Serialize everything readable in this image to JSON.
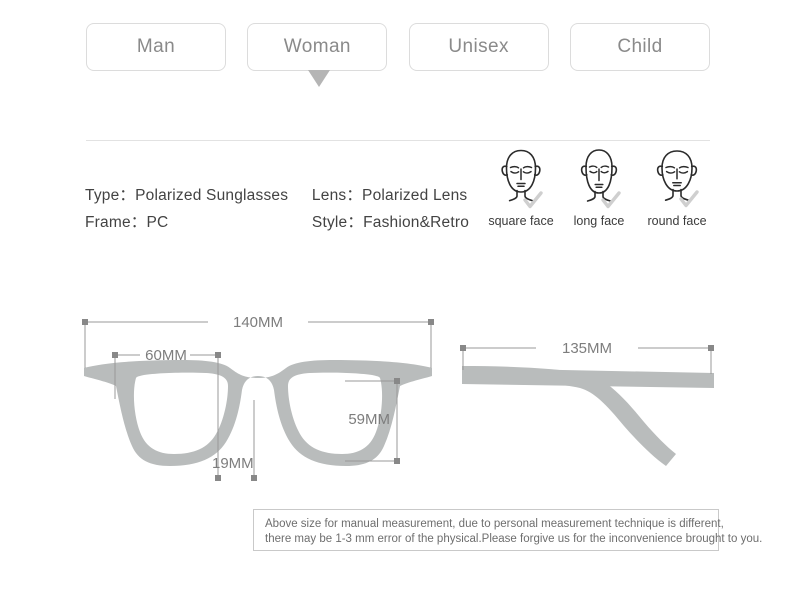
{
  "tabs": {
    "items": [
      {
        "label": "Man",
        "selected": false
      },
      {
        "label": "Woman",
        "selected": true
      },
      {
        "label": "Unisex",
        "selected": false
      },
      {
        "label": "Child",
        "selected": false
      }
    ]
  },
  "specs": {
    "rows": [
      {
        "left": "Type：Polarized Sunglasses",
        "right": "Lens：Polarized Lens"
      },
      {
        "left": "Frame：PC",
        "right": "Style：Fashion&Retro"
      }
    ]
  },
  "faces": {
    "items": [
      {
        "label": "square face"
      },
      {
        "label": "long face"
      },
      {
        "label": "round face"
      }
    ]
  },
  "dimensions": {
    "front": {
      "total_width": "140MM",
      "lens_width": "60MM",
      "lens_height": "59MM",
      "bridge_width": "19MM"
    },
    "temple": {
      "length": "135MM"
    }
  },
  "note": {
    "line1": "Above size for manual measurement, due to personal measurement technique is different,",
    "line2": "there may be 1-3 mm error of the physical.Please forgive us for the inconvenience brought to you."
  },
  "colors": {
    "frame_gray": "#b9bcbc",
    "border_gray": "#dcdcdc",
    "text_gray": "#444444",
    "dimension_gray": "#8a8a8a",
    "pointer_gray": "#b5b5b5"
  }
}
